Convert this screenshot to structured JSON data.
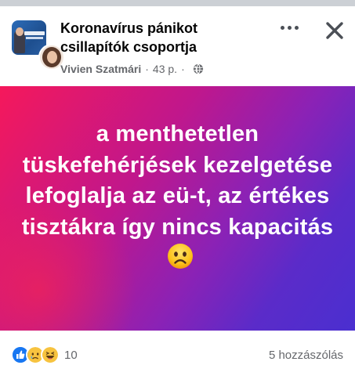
{
  "header": {
    "group_name": "Koronavírus pánikot csillapítók csoportja",
    "author": "Vivien Szatmári",
    "time": "43 p.",
    "separator": "·",
    "privacy_icon": "globe-icon",
    "more_icon": "more-horizontal-icon",
    "close_icon": "close-icon"
  },
  "post": {
    "text": "a menthetetlen tüskefehérjések kezelgetése lefoglalja az eü-t, az értékes tisztákra így nincs kapacitás",
    "emoji": "frowning-face-emoji",
    "colors": {
      "gradient_start": "#f5185b",
      "gradient_mid": "#8a22b6",
      "gradient_end": "#4a2fd0",
      "text": "#ffffff"
    }
  },
  "footer": {
    "reaction_icons": [
      "like-reaction-icon",
      "sad-reaction-icon",
      "haha-reaction-icon"
    ],
    "reaction_count": "10",
    "comments": "5 hozzászólás"
  }
}
